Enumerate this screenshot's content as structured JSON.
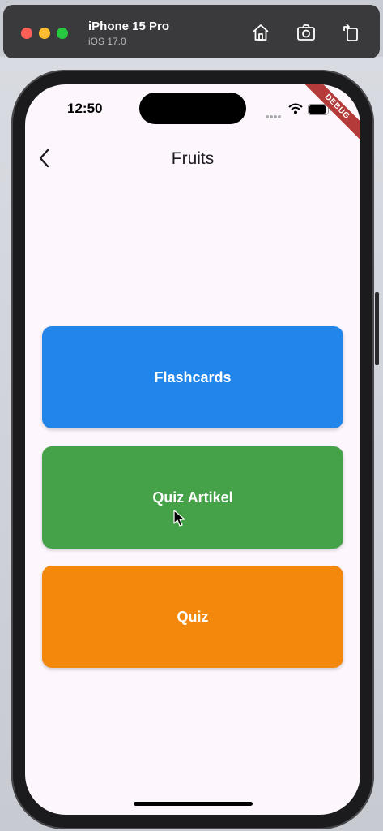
{
  "simulator": {
    "device_name": "iPhone 15 Pro",
    "os_version": "iOS 17.0",
    "icons": [
      "home-icon",
      "screenshot-icon",
      "rotate-icon"
    ]
  },
  "status_bar": {
    "time": "12:50"
  },
  "debug_banner": "DEBUG",
  "app_bar": {
    "title": "Fruits",
    "back_icon": "chevron-left-icon"
  },
  "menu": [
    {
      "label": "Flashcards",
      "color": "#2185ea"
    },
    {
      "label": "Quiz Artikel",
      "color": "#45a249"
    },
    {
      "label": "Quiz",
      "color": "#f3880d"
    }
  ]
}
